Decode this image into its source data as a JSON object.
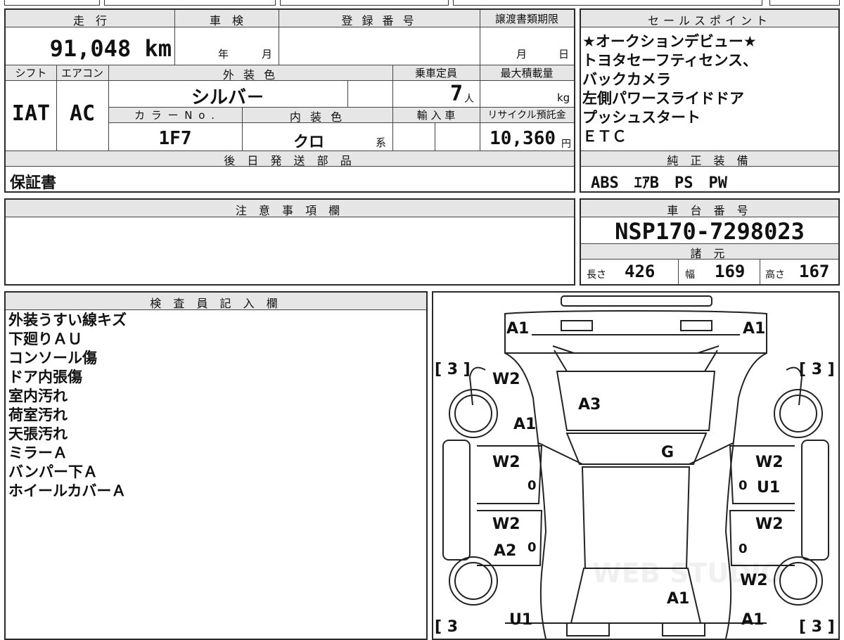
{
  "vehicle_info": {
    "mileage_header": "走　行",
    "mileage_value": "91,048",
    "mileage_unit": "km",
    "inspection_header": "車　検",
    "inspection_year": "年",
    "inspection_month": "月",
    "registration_header": "登 録 番 号",
    "transfer_header": "譲渡書類期限",
    "transfer_month": "月",
    "transfer_day": "日",
    "shift_header": "シフト",
    "shift_value": "IAT",
    "ac_header": "エアコン",
    "ac_value": "AC",
    "exterior_color_header": "外 装 色",
    "exterior_color_value": "シルバ－",
    "capacity_header": "乗車定員",
    "capacity_value": "7",
    "capacity_unit": "人",
    "max_load_header": "最大積載量",
    "max_load_unit": "kg",
    "color_no_header": "カ ラ ー N o .",
    "color_no_value": "1F7",
    "interior_color_header": "内 装 色",
    "interior_color_value": "クロ",
    "interior_color_suffix": "系",
    "import_header": "輸 入 車",
    "recycle_header": "リサイクル預託金",
    "recycle_value": "10,360",
    "recycle_unit": "円",
    "later_parts_header": "後 日 発 送 部 品",
    "later_parts_value": "保証書"
  },
  "sales_points": {
    "header": "セールスポイント",
    "lines": [
      "★オークションデビュー★",
      "トヨタセーフティセンス、",
      "バックカメラ",
      "左側パワースライドドア",
      "プッシュスタート",
      "ＥＴＣ"
    ]
  },
  "standard_equipment": {
    "header": "純 正 装 備",
    "value": "ABS　ｴｱB　PS　PW"
  },
  "notes": {
    "header": "注 意 事 項 欄",
    "value": ""
  },
  "chassis": {
    "header": "車 台 番 号",
    "value": "NSP170-7298023"
  },
  "specs": {
    "header": "諸 元",
    "length_label": "長さ",
    "length_value": "426",
    "width_label": "幅",
    "width_value": "169",
    "height_label": "高さ",
    "height_value": "167"
  },
  "inspector": {
    "header": "検 査 員 記 入 欄",
    "lines": [
      "外装うすい線キズ",
      "下廻りＡＵ",
      "コンソール傷",
      "ドア内張傷",
      "室内汚れ",
      "荷室汚れ",
      "天張汚れ",
      "ミラーＡ",
      "バンパー下Ａ",
      "ホイールカバーＡ"
    ]
  },
  "diagram": {
    "codes": {
      "front_left": "A1",
      "front_right": "A1",
      "bracket_fl": "[ 3 ]",
      "bracket_fr": "[ 3 ]",
      "bracket_rl": "[ 3",
      "bracket_rr": "[ 3 ]",
      "left_fender_w": "W2",
      "left_fender_a": "A1",
      "hood": "A3",
      "windshield": "G",
      "left_front_door": "W2",
      "left_front_door_zero": "0",
      "right_front_door": "W2",
      "right_front_door_zero": "0",
      "right_front_door_u": "U1",
      "left_rear_door_w": "W2",
      "left_rear_door_a": "A2",
      "left_rear_door_zero": "0",
      "right_rear_door": "W2",
      "right_rear_door_zero": "0",
      "right_quarter": "W2",
      "roof_rear": "A1",
      "rear_left": "U1",
      "rear_right": "A1"
    },
    "watermark": "WEB STUDIO"
  }
}
